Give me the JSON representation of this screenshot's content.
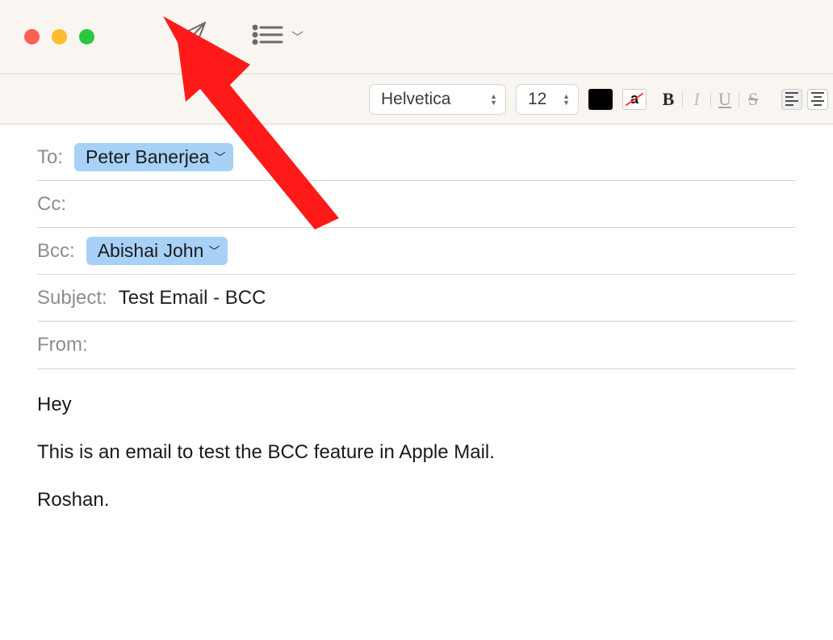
{
  "toolbar": {
    "font_name": "Helvetica",
    "font_size": "12"
  },
  "header": {
    "to_label": "To:",
    "to_recipient": "Peter Banerjea",
    "cc_label": "Cc:",
    "bcc_label": "Bcc:",
    "bcc_recipient": "Abishai John",
    "subject_label": "Subject:",
    "subject_value": "Test Email - BCC",
    "from_label": "From:"
  },
  "body": {
    "line1": "Hey",
    "line2": "This is an email to test the BCC feature in Apple Mail.",
    "line3": "Roshan."
  }
}
